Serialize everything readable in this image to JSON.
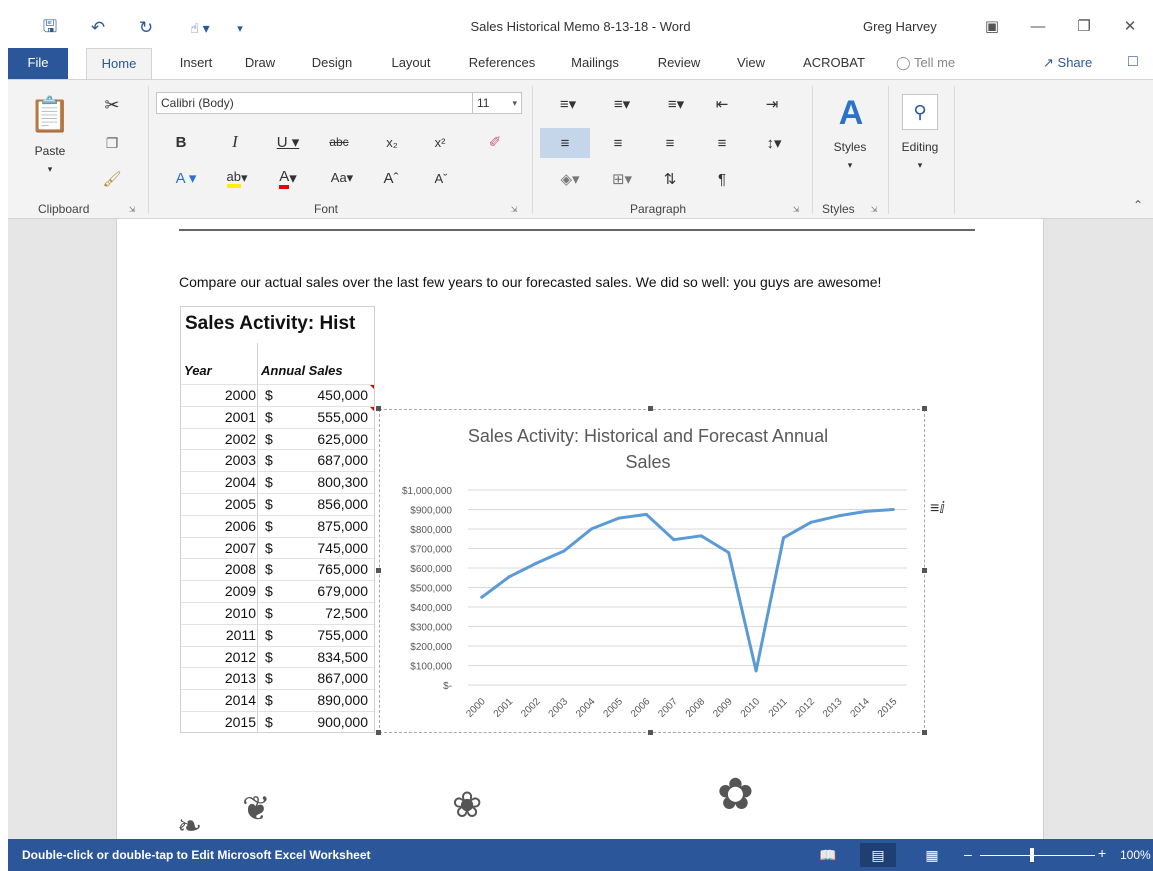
{
  "app": {
    "doc_title": "Sales Historical Memo 8-13-18  -  Word",
    "user_name": "Greg Harvey"
  },
  "tabs": [
    {
      "label": "File"
    },
    {
      "label": "Home"
    },
    {
      "label": "Insert"
    },
    {
      "label": "Draw"
    },
    {
      "label": "Design"
    },
    {
      "label": "Layout"
    },
    {
      "label": "References"
    },
    {
      "label": "Mailings"
    },
    {
      "label": "Review"
    },
    {
      "label": "View"
    },
    {
      "label": "ACROBAT"
    }
  ],
  "tell_me": "Tell me",
  "share_label": "Share",
  "ribbon": {
    "clipboard": {
      "label": "Clipboard",
      "paste": "Paste"
    },
    "font": {
      "label": "Font",
      "font_name": "Calibri (Body)",
      "font_size": "11"
    },
    "paragraph": {
      "label": "Paragraph"
    },
    "styles": {
      "label": "Styles",
      "button": "Styles"
    },
    "editing": {
      "button": "Editing"
    }
  },
  "document": {
    "paragraph": "Compare our actual sales over the last few years to our forecasted sales. We did so well: you guys are awesome!",
    "table": {
      "title": "Sales Activity: Hist",
      "headers": {
        "year": "Year",
        "sales": "Annual Sales"
      },
      "currency": "$",
      "rows": [
        {
          "year": "2000",
          "value": "450,000"
        },
        {
          "year": "2001",
          "value": "555,000"
        },
        {
          "year": "2002",
          "value": "625,000"
        },
        {
          "year": "2003",
          "value": "687,000"
        },
        {
          "year": "2004",
          "value": "800,300"
        },
        {
          "year": "2005",
          "value": "856,000"
        },
        {
          "year": "2006",
          "value": "875,000"
        },
        {
          "year": "2007",
          "value": "745,000"
        },
        {
          "year": "2008",
          "value": "765,000"
        },
        {
          "year": "2009",
          "value": "679,000"
        },
        {
          "year": "2010",
          "value": "72,500"
        },
        {
          "year": "2011",
          "value": "755,000"
        },
        {
          "year": "2012",
          "value": "834,500"
        },
        {
          "year": "2013",
          "value": "867,000"
        },
        {
          "year": "2014",
          "value": "890,000"
        },
        {
          "year": "2015",
          "value": "900,000"
        }
      ]
    }
  },
  "chart_data": {
    "type": "line",
    "title": "Sales Activity: Historical and Forecast Annual Sales",
    "title_line1": "Sales Activity: Historical and Forecast Annual",
    "title_line2": "Sales",
    "categories": [
      "2000",
      "2001",
      "2002",
      "2003",
      "2004",
      "2005",
      "2006",
      "2007",
      "2008",
      "2009",
      "2010",
      "2011",
      "2012",
      "2013",
      "2014",
      "2015"
    ],
    "values": [
      450000,
      555000,
      625000,
      687000,
      800300,
      856000,
      875000,
      745000,
      765000,
      679000,
      72500,
      755000,
      834500,
      867000,
      890000,
      900000
    ],
    "ylim": [
      0,
      1000000
    ],
    "yticks": [
      "$-",
      "$100,000",
      "$200,000",
      "$300,000",
      "$400,000",
      "$500,000",
      "$600,000",
      "$700,000",
      "$800,000",
      "$900,000",
      "$1,000,000"
    ],
    "grid": true,
    "line_color": "#5b9bd5"
  },
  "status": {
    "message": "Double-click or double-tap to Edit Microsoft Excel Worksheet",
    "zoom": "100%"
  },
  "colors": {
    "accent": "#2b579a"
  }
}
